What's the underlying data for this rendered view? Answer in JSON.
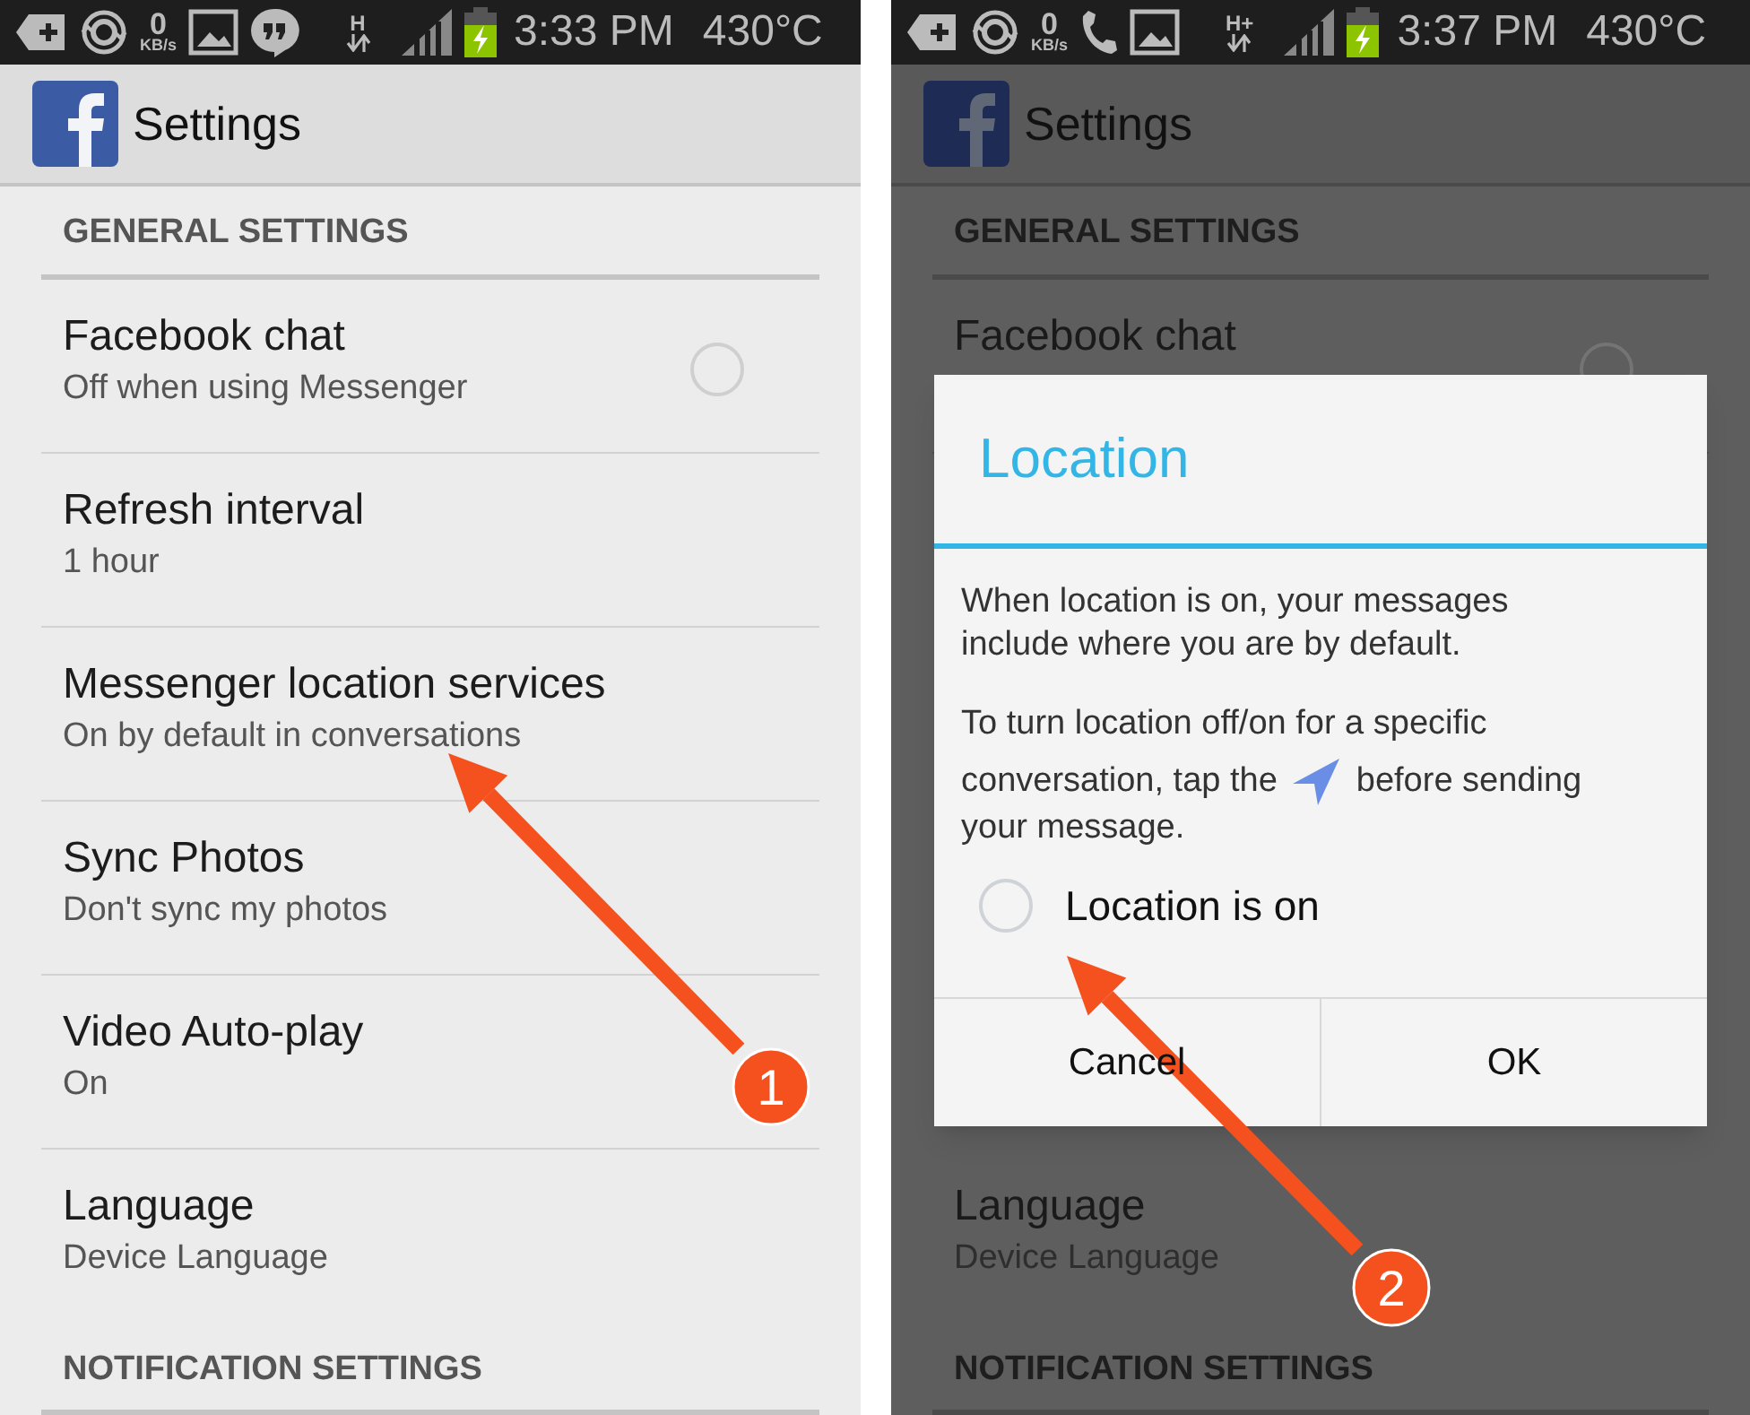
{
  "screens": [
    {
      "dimmed": false,
      "status_bar": {
        "data_rate": "0",
        "data_unit": "KB/s",
        "network": "H",
        "time": "3:33 PM",
        "temperature": "430°C",
        "icons": [
          {
            "kind": "plus-tag"
          },
          {
            "kind": "sync"
          },
          {
            "kind": "rate"
          },
          {
            "kind": "image"
          },
          {
            "kind": "chat"
          }
        ]
      },
      "app_bar": {
        "title": "Settings"
      },
      "sections": [
        {
          "header": "GENERAL SETTINGS",
          "items": [
            {
              "title": "Facebook chat",
              "subtitle": "Off when using Messenger",
              "kind": "checkbox",
              "checked": false
            },
            {
              "title": "Refresh interval",
              "subtitle": "1 hour",
              "kind": "plain"
            },
            {
              "title": "Messenger location services",
              "subtitle": "On by default in conversations",
              "kind": "plain"
            },
            {
              "title": "Sync Photos",
              "subtitle": "Don't sync my photos",
              "kind": "plain"
            },
            {
              "title": "Video Auto-play",
              "subtitle": "On",
              "kind": "plain"
            },
            {
              "title": "Language",
              "subtitle": "Device Language",
              "kind": "plain"
            }
          ]
        },
        {
          "header": "NOTIFICATION SETTINGS"
        }
      ]
    },
    {
      "dimmed": true,
      "status_bar": {
        "data_rate": "0",
        "data_unit": "KB/s",
        "network": "H+",
        "time": "3:37 PM",
        "temperature": "430°C",
        "icons": [
          {
            "kind": "plus-tag"
          },
          {
            "kind": "sync"
          },
          {
            "kind": "rate"
          },
          {
            "kind": "phone"
          },
          {
            "kind": "image"
          }
        ]
      },
      "app_bar": {
        "title": "Settings"
      },
      "sections": [
        {
          "header": "GENERAL SETTINGS",
          "items": [
            {
              "title": "Facebook chat",
              "kind": "checkbox"
            },
            {
              "kind": "covered"
            },
            {
              "title": "Language",
              "subtitle": "Device Language",
              "kind": "plain"
            }
          ]
        },
        {
          "header": "NOTIFICATION SETTINGS"
        }
      ],
      "dialog": {
        "title": "Location",
        "message": "When location is on, your messages include where you are by default.",
        "hint_line_1": "To turn location off/on for a specific",
        "hint_before_icon": "conversation, tap the",
        "hint_after_icon": "before sending",
        "hint_line_3": "your message.",
        "option": {
          "label": "Location is on",
          "checked": false
        },
        "buttons": [
          "Cancel",
          "OK"
        ]
      }
    }
  ],
  "annotations": [
    {
      "number": "1"
    },
    {
      "number": "2"
    }
  ]
}
